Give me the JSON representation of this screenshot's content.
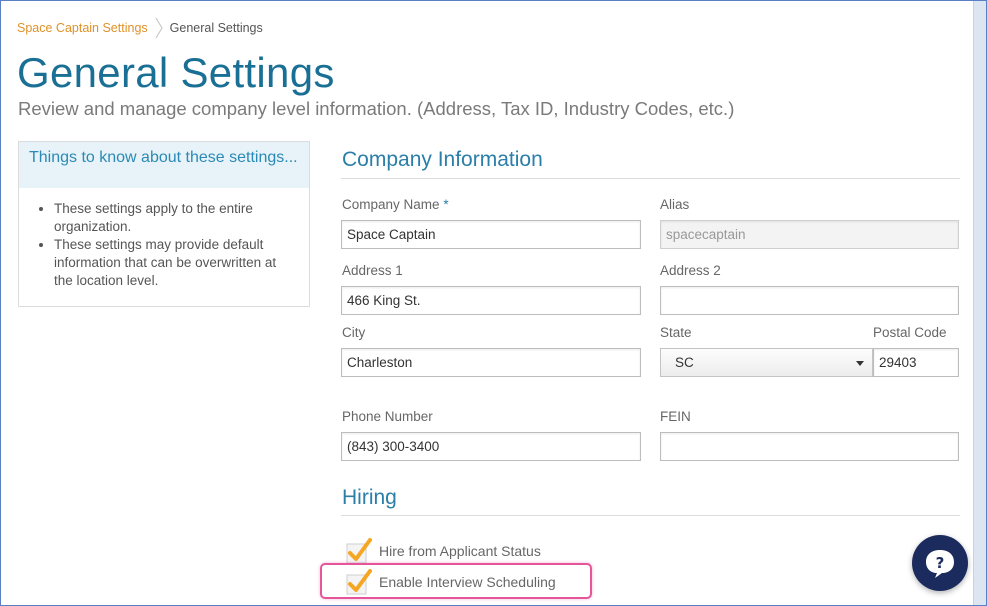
{
  "breadcrumb": {
    "parent": "Space Captain Settings",
    "current": "General Settings"
  },
  "page": {
    "title": "General Settings",
    "subtitle": "Review and manage company level information. (Address, Tax ID, Industry Codes, etc.)"
  },
  "info_box": {
    "heading": "Things to know about these settings...",
    "items": [
      "These settings apply to the entire organization.",
      "These settings may provide default information that can be overwritten at the location level."
    ]
  },
  "company_info": {
    "section_title": "Company Information",
    "company_name": {
      "label": "Company Name",
      "required_mark": "*",
      "value": "Space Captain"
    },
    "alias": {
      "label": "Alias",
      "value": "spacecaptain"
    },
    "address1": {
      "label": "Address 1",
      "value": "466 King St."
    },
    "address2": {
      "label": "Address 2",
      "value": ""
    },
    "city": {
      "label": "City",
      "value": "Charleston"
    },
    "state": {
      "label": "State",
      "value": "SC"
    },
    "postal_code": {
      "label": "Postal Code",
      "value": "29403"
    },
    "phone": {
      "label": "Phone Number",
      "value": "(843) 300-3400"
    },
    "fein": {
      "label": "FEIN",
      "value": ""
    }
  },
  "hiring": {
    "section_title": "Hiring",
    "options": [
      {
        "label": "Hire from Applicant Status",
        "checked": true
      },
      {
        "label": "Enable Interview Scheduling",
        "checked": true
      }
    ]
  },
  "icons": {
    "breadcrumb_separator": "chevron-right-icon",
    "check": "checkmark-icon",
    "help": "help-chat-icon"
  },
  "colors": {
    "title": "#1a6f94",
    "accent": "#2a7ea8",
    "breadcrumb_link": "#e0922a",
    "check": "#f5a623",
    "highlight": "#e5559a",
    "help_button": "#1c2b5e"
  }
}
